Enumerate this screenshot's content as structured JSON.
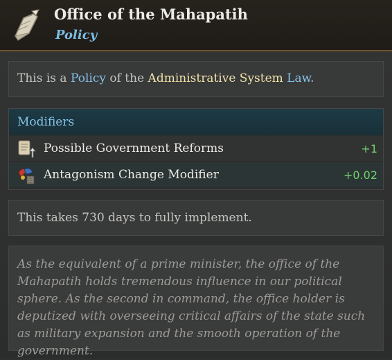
{
  "header": {
    "title": "Office of the Mahapatih",
    "subtitle": "Policy",
    "icon": "scroll-quill-icon"
  },
  "description": {
    "prefix": "This is a ",
    "type_word": "Policy",
    "middle": " of the ",
    "law_name": "Administrative System",
    "law_word": " Law",
    "suffix": "."
  },
  "modifiers": {
    "title": "Modifiers",
    "items": [
      {
        "label": "Possible Government Reforms",
        "value": "+1",
        "icon": "reform-scroll-icon"
      },
      {
        "label": "Antagonism Change Modifier",
        "value": "+0.02",
        "icon": "antagonism-icon"
      }
    ]
  },
  "implement": {
    "text": "This takes 730 days to fully implement."
  },
  "flavor": {
    "text": "As the equivalent of a prime minister, the office of the Mahapatih holds tremendous influence in our political sphere. As the second in command, the office holder is deputized with overseeing critical affairs of the state such as military expansion and the smooth operation of the government."
  },
  "colors": {
    "accent_blue": "#86c3e8",
    "law_yellow": "#efe2a8",
    "positive_green": "#6fd36a",
    "header_border": "#6b5636"
  }
}
